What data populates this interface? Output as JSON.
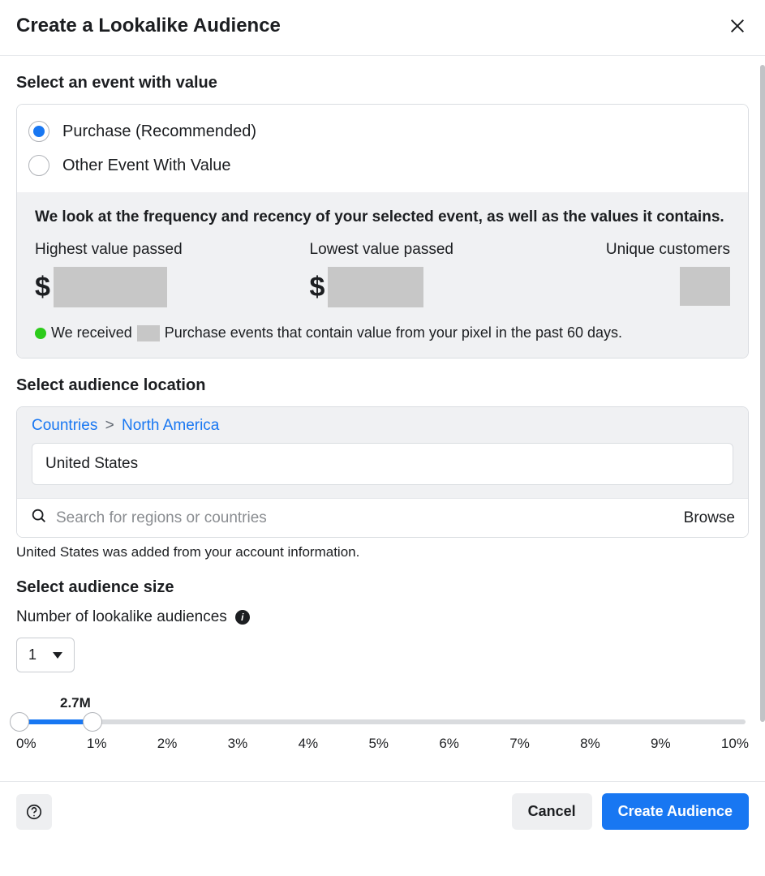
{
  "header": {
    "title": "Create a Lookalike Audience"
  },
  "event_section": {
    "title": "Select an event with value",
    "options": [
      {
        "label": "Purchase (Recommended)",
        "selected": true
      },
      {
        "label": "Other Event With Value",
        "selected": false
      }
    ],
    "stats_description": "We look at the frequency and recency of your selected event, as well as the values it contains.",
    "highest_label": "Highest value passed",
    "lowest_label": "Lowest value passed",
    "unique_label": "Unique customers",
    "currency_symbol": "$",
    "events_line_pre": "We received",
    "events_line_post": "Purchase events that contain value from your pixel in the past 60 days."
  },
  "location_section": {
    "title": "Select audience location",
    "breadcrumb_root": "Countries",
    "breadcrumb_region": "North America",
    "breadcrumb_sep": ">",
    "selected_value": "United States",
    "search_placeholder": "Search for regions or countries",
    "browse_label": "Browse",
    "hint": "United States was added from your account information."
  },
  "size_section": {
    "title": "Select audience size",
    "num_label": "Number of lookalike audiences",
    "num_value": "1",
    "estimate": "2.7M",
    "ticks": [
      "0%",
      "1%",
      "2%",
      "3%",
      "4%",
      "5%",
      "6%",
      "7%",
      "8%",
      "9%",
      "10%"
    ]
  },
  "footer": {
    "cancel": "Cancel",
    "create": "Create Audience"
  }
}
